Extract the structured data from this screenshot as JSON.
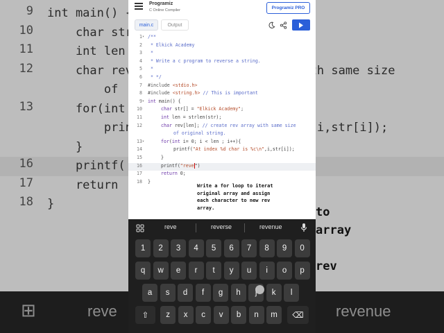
{
  "background": {
    "code_lines": [
      {
        "ln": "9",
        "text": "int main() {",
        "hl": false
      },
      {
        "ln": "10",
        "text": "    char str",
        "hl": false
      },
      {
        "ln": "11",
        "text": "    int len",
        "hl": false
      },
      {
        "ln": "12",
        "text": "    char rev                    ay with same size",
        "hl": false
      },
      {
        "ln": "",
        "text": "        of",
        "hl": false
      },
      {
        "ln": "13",
        "text": "    for(int",
        "hl": false
      },
      {
        "ln": "",
        "text": "        prin                    %c\\n\",i,str[i]);",
        "hl": false
      },
      {
        "ln": "",
        "text": "    }",
        "hl": false
      },
      {
        "ln": "16",
        "text": "    printf(",
        "hl": true
      },
      {
        "ln": "17",
        "text": "    return",
        "hl": false
      },
      {
        "ln": "18",
        "text": "}",
        "hl": false
      }
    ],
    "right_text": [
      "to",
      "array",
      "",
      "rev"
    ],
    "keyboard": {
      "left": "reve",
      "right": "revenue"
    }
  },
  "header": {
    "logo": "Programiz",
    "subtitle": "C Online Compiler",
    "pro_button": "Programiz PRO"
  },
  "tabs": {
    "main": "main.c",
    "output": "Output"
  },
  "code": [
    {
      "n": "1",
      "fold": "▾",
      "indent": 0,
      "parts": [
        [
          "cm",
          "/**"
        ]
      ]
    },
    {
      "n": "2",
      "fold": "",
      "indent": 0,
      "parts": [
        [
          "cm",
          " * Elkick Academy"
        ]
      ]
    },
    {
      "n": "3",
      "fold": "",
      "indent": 0,
      "parts": [
        [
          "cm",
          " *"
        ]
      ]
    },
    {
      "n": "4",
      "fold": "",
      "indent": 0,
      "parts": [
        [
          "cm",
          " * Write a c program to reverse a string."
        ]
      ]
    },
    {
      "n": "5",
      "fold": "",
      "indent": 0,
      "parts": [
        [
          "cm",
          " *"
        ]
      ]
    },
    {
      "n": "6",
      "fold": "",
      "indent": 0,
      "parts": [
        [
          "cm",
          " * */"
        ]
      ]
    },
    {
      "n": "7",
      "fold": "",
      "indent": 0,
      "parts": [
        [
          "pp",
          "#include "
        ],
        [
          "str",
          "<stdio.h>"
        ]
      ]
    },
    {
      "n": "8",
      "fold": "",
      "indent": 0,
      "parts": [
        [
          "pp",
          "#include "
        ],
        [
          "str",
          "<string.h>"
        ],
        [
          "cm",
          " // This is important"
        ]
      ]
    },
    {
      "n": "9",
      "fold": "▾",
      "indent": 0,
      "parts": [
        [
          "kw",
          "int"
        ],
        [
          "",
          " main() {"
        ]
      ]
    },
    {
      "n": "10",
      "fold": "",
      "indent": 1,
      "parts": [
        [
          "kw",
          "char"
        ],
        [
          "",
          " str[] = "
        ],
        [
          "str",
          "\"Elkick Academy\""
        ],
        [
          "",
          ";"
        ]
      ]
    },
    {
      "n": "11",
      "fold": "",
      "indent": 1,
      "parts": [
        [
          "kw",
          "int"
        ],
        [
          "",
          " len = strlen(str);"
        ]
      ]
    },
    {
      "n": "12",
      "fold": "",
      "indent": 1,
      "parts": [
        [
          "kw",
          "char"
        ],
        [
          "",
          " rev[len]; "
        ],
        [
          "cm",
          "// create rev array with same size"
        ]
      ]
    },
    {
      "n": "",
      "fold": "",
      "indent": 2,
      "parts": [
        [
          "cm",
          "of original string."
        ]
      ]
    },
    {
      "n": "13",
      "fold": "▾",
      "indent": 1,
      "parts": [
        [
          "kw",
          "for"
        ],
        [
          "",
          "("
        ],
        [
          "kw",
          "int"
        ],
        [
          "",
          " i= 0; i < len ; i++){"
        ]
      ]
    },
    {
      "n": "14",
      "fold": "",
      "indent": 2,
      "parts": [
        [
          "",
          "printf("
        ],
        [
          "str",
          "\"At index %d char is %c\\n\""
        ],
        [
          "",
          ",i,str[i]);"
        ]
      ]
    },
    {
      "n": "15",
      "fold": "",
      "indent": 1,
      "parts": [
        [
          "",
          "}"
        ]
      ]
    },
    {
      "n": "16",
      "fold": "",
      "indent": 1,
      "active": true,
      "parts": [
        [
          "",
          "printf("
        ],
        [
          "str",
          "\"reve"
        ],
        [
          "",
          "\")"
        ]
      ]
    },
    {
      "n": "17",
      "fold": "",
      "indent": 1,
      "parts": [
        [
          "kw",
          "return"
        ],
        [
          "",
          " 0;"
        ]
      ]
    },
    {
      "n": "18",
      "fold": "",
      "indent": 0,
      "parts": [
        [
          "",
          "}"
        ]
      ]
    }
  ],
  "tooltip": "Write a for loop to iterat original array and assign each character to new rev array.",
  "keyboard": {
    "suggestions": [
      "reve",
      "reverse",
      "revenue"
    ],
    "row_numbers": [
      "1",
      "2",
      "3",
      "4",
      "5",
      "6",
      "7",
      "8",
      "9",
      "0"
    ],
    "row1": [
      "q",
      "w",
      "e",
      "r",
      "t",
      "y",
      "u",
      "i",
      "o",
      "p"
    ],
    "row2": [
      "a",
      "s",
      "d",
      "f",
      "g",
      "h",
      "j",
      "k",
      "l"
    ],
    "row3": [
      "z",
      "x",
      "c",
      "v",
      "b",
      "n",
      "m"
    ]
  },
  "colors": {
    "accent": "#2b5fd9",
    "keyboard_bg": "#1f1f1f",
    "key_bg": "#3c3c3c"
  }
}
